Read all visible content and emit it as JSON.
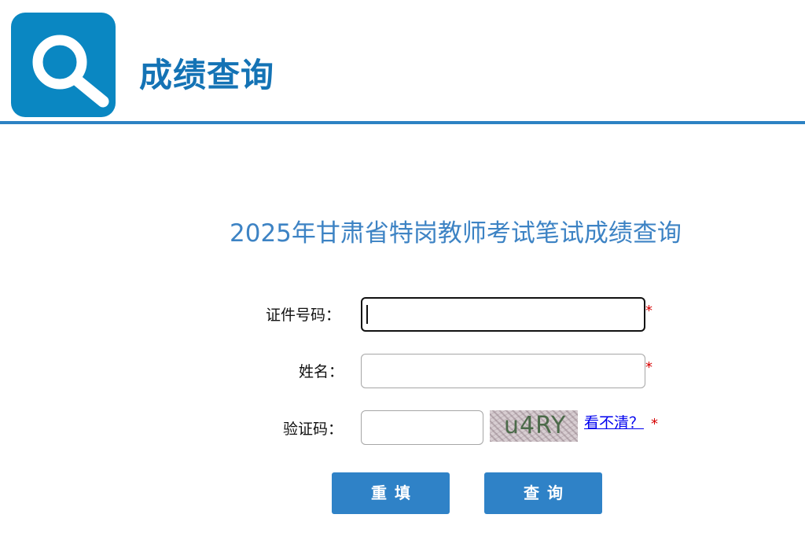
{
  "header": {
    "icon": "search-icon",
    "title": "成绩查询",
    "accent_color": "#2d82c3",
    "icon_bg_color": "#0a87c2"
  },
  "main": {
    "heading": "2025年甘肃省特岗教师考试笔试成绩查询",
    "form": {
      "id_label": "证件号码：",
      "id_value": "",
      "name_label": "姓名：",
      "name_value": "",
      "captcha_label": "验证码：",
      "captcha_value": "",
      "captcha_image_text": "u4RY",
      "refresh_link": "看不清？",
      "required_mark": "*"
    },
    "buttons": {
      "reset_label": "重填",
      "query_label": "查询",
      "button_color": "#2f82c7"
    }
  }
}
